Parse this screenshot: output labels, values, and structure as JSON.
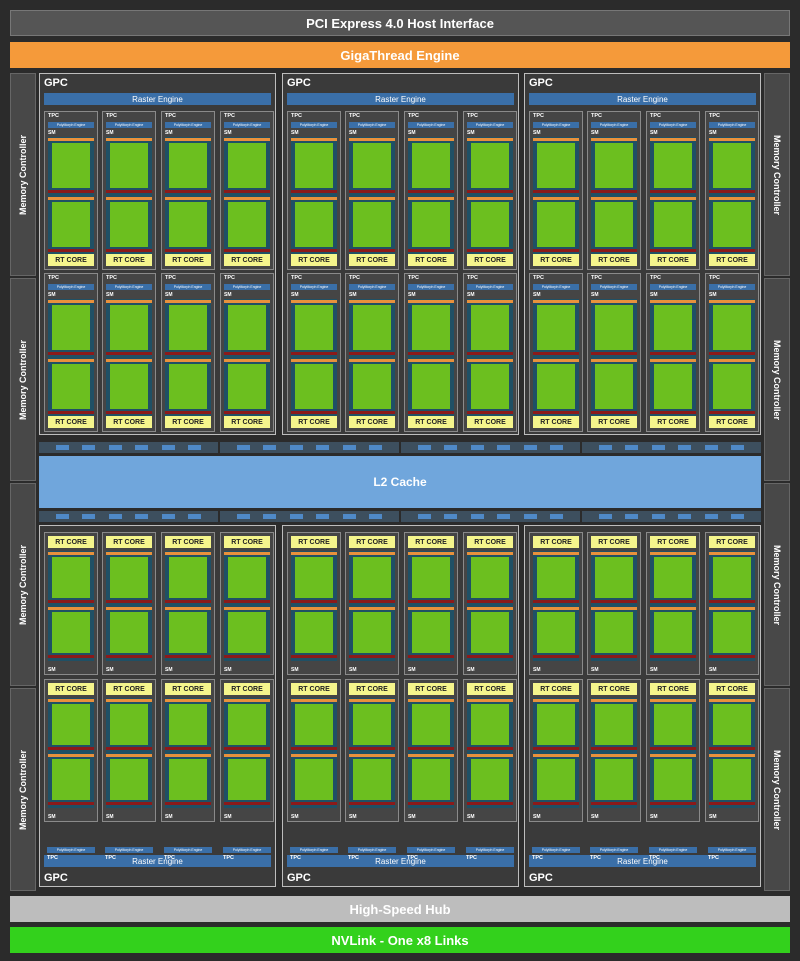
{
  "header": {
    "pcie_label": "PCI Express 4.0 Host Interface",
    "gigathread_label": "GigaThread Engine"
  },
  "footer": {
    "hub_label": "High-Speed Hub",
    "nvlink_label": "NVLink - One x8 Links"
  },
  "l2_label": "L2 Cache",
  "memory_controller_label": "Memory Controller",
  "gpc_label": "GPC",
  "raster_label": "Raster Engine",
  "tpc_label": "TPC",
  "sm_label": "SM",
  "polymorph_label": "PolyMorph Engine",
  "rt_core_label": "RT CORE",
  "layout": {
    "gpcs": 6,
    "tpcs_per_gpc": 4,
    "sms_per_tpc": 2,
    "memory_controllers_per_side": 4
  },
  "colors": {
    "background": "#2b2b2b",
    "gigathread": "#f59a3a",
    "l2": "#70a6dc",
    "hub": "#bdbdbd",
    "nvlink": "#33d11c",
    "raster": "#3a6fa8",
    "rt_core": "#f5f58c",
    "cuda_core": "#6cbf1f"
  }
}
